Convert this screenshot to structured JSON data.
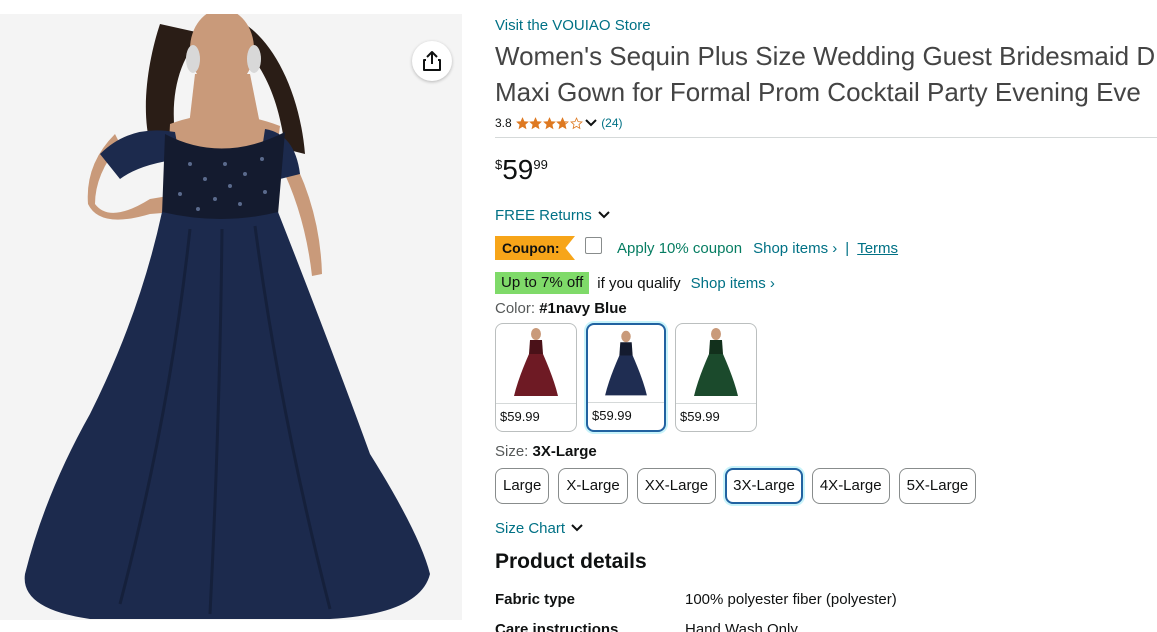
{
  "image": {
    "share_icon": "share-icon",
    "colors": {
      "background": "#f4f4f4",
      "dress": "#1c2a4d",
      "bodice": "#141b2f",
      "skin": "#c99a7a",
      "hair": "#2a1d16"
    }
  },
  "product": {
    "store_link": "Visit the VOUIAO Store",
    "title_line1": "Women's Sequin Plus Size Wedding Guest Bridesmaid D",
    "title_line2": "Maxi Gown for Formal Prom Cocktail Party Evening Eve",
    "rating_value": "3.8",
    "rating_stars": 3.8,
    "rating_count": "(24)",
    "price_symbol": "$",
    "price_whole": "59",
    "price_fraction": "99",
    "returns_label": "FREE Returns",
    "coupon_badge": "Coupon:",
    "coupon_apply": "Apply 10% coupon",
    "coupon_shop": "Shop items ›",
    "coupon_sep": "|",
    "coupon_terms": "Terms",
    "promo_badge": "Up to 7% off",
    "promo_text": "if you qualify",
    "promo_shop": "Shop items ›"
  },
  "color": {
    "label": "Color:",
    "selected": "#1navy Blue",
    "options": [
      {
        "price": "$59.99",
        "color": "#6e1a24"
      },
      {
        "price": "$59.99",
        "color": "#1f2d52"
      },
      {
        "price": "$59.99",
        "color": "#1b4a2c"
      }
    ]
  },
  "size": {
    "label": "Size:",
    "selected": "3X-Large",
    "options": [
      "Large",
      "X-Large",
      "XX-Large",
      "3X-Large",
      "4X-Large",
      "5X-Large"
    ]
  },
  "size_chart": "Size Chart",
  "details": {
    "title": "Product details",
    "rows": [
      {
        "key": "Fabric type",
        "value": "100% polyester fiber (polyester)"
      },
      {
        "key": "Care instructions",
        "value": "Hand Wash Only"
      }
    ]
  },
  "colors": {
    "link": "#007185",
    "coupon": "#f7a519",
    "promo": "#7fda69",
    "selected_border": "#2162a1",
    "star": "#de7921"
  }
}
